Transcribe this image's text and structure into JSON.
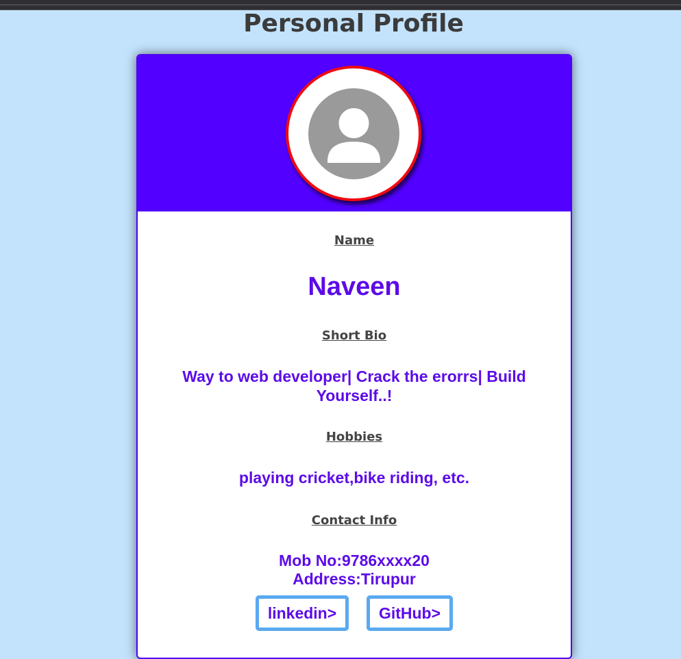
{
  "page": {
    "title": "Personal Profile"
  },
  "colors": {
    "background": "#c3e3fd",
    "header": "#5200ff",
    "avatar_border": "#f00a12",
    "accent_text": "#5c0be8",
    "label_text": "#444444",
    "button_border": "#5aa9f0"
  },
  "profile": {
    "avatar_icon": "person-silhouette-icon",
    "name_label": "Name",
    "name": "Naveen",
    "bio_label": "Short Bio",
    "bio": "Way to web developer| Crack the erorrs| Build Yourself..!",
    "hobbies_label": "Hobbies",
    "hobbies": "playing cricket,bike riding, etc.",
    "contact_label": "Contact Info",
    "mobile": "Mob No:9786xxxx20",
    "address": "Address:Tirupur"
  },
  "links": {
    "linkedin_label": "linkedin>",
    "github_label": "GitHub>"
  }
}
